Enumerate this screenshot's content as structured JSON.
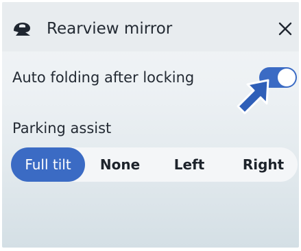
{
  "window": {
    "title": "Rearview mirror",
    "title_icon": "side-mirror-icon",
    "close_icon": "close-icon"
  },
  "settings": {
    "auto_folding": {
      "label": "Auto folding after locking",
      "enabled": true
    },
    "parking_assist": {
      "label": "Parking assist",
      "options": [
        "Full tilt",
        "None",
        "Left",
        "Right"
      ],
      "selected": "Full tilt"
    }
  },
  "annotation": {
    "icon": "pointer-arrow-icon"
  },
  "colors": {
    "accent": "#3b6bc4",
    "panel_bg": "#edf1f4",
    "text": "#232a33"
  }
}
